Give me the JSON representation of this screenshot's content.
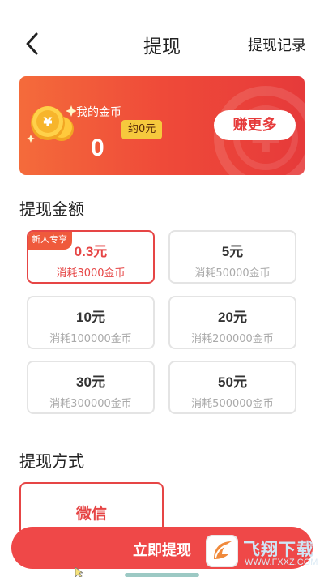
{
  "header": {
    "title": "提现",
    "history_link": "提现记录"
  },
  "coin_card": {
    "label": "我的金币",
    "value": "0",
    "approx": "约0元",
    "earn_button": "赚更多",
    "coin_symbol": "¥",
    "watermark_symbol": "¥",
    "gradient_start": "#f46b3b",
    "gradient_end": "#e63a3a"
  },
  "withdraw_amount": {
    "section_title": "提现金额",
    "options": [
      {
        "amount": "0.3元",
        "cost": "消耗3000金币",
        "tag": "新人专享",
        "selected": true
      },
      {
        "amount": "5元",
        "cost": "消耗50000金币"
      },
      {
        "amount": "10元",
        "cost": "消耗100000金币"
      },
      {
        "amount": "20元",
        "cost": "消耗200000金币"
      },
      {
        "amount": "30元",
        "cost": "消耗300000金币"
      },
      {
        "amount": "50元",
        "cost": "消耗500000金币"
      }
    ]
  },
  "withdraw_method": {
    "section_title": "提现方式",
    "options": [
      {
        "label": "微信",
        "selected": true
      }
    ]
  },
  "submit_button": {
    "label": "立即提现",
    "color": "#ef4848"
  },
  "watermark_logo": {
    "title": "飞翔下载",
    "url": "WWW.FXXZ.COM"
  },
  "accent_color": "#e64545"
}
